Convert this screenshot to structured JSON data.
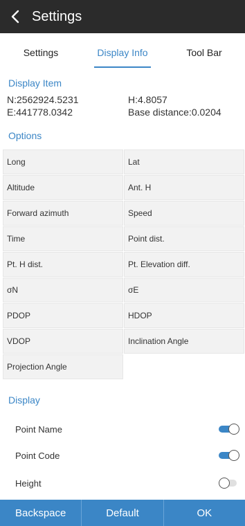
{
  "header": {
    "title": "Settings"
  },
  "tabs": [
    {
      "label": "Settings",
      "active": false
    },
    {
      "label": "Display Info",
      "active": true
    },
    {
      "label": "Tool Bar",
      "active": false
    }
  ],
  "display_item": {
    "title": "Display Item",
    "rows": [
      {
        "left": "N:2562924.5231",
        "right": "H:4.8057"
      },
      {
        "left": "E:441778.0342",
        "right": "Base distance:0.0204"
      }
    ]
  },
  "options": {
    "title": "Options",
    "items": [
      "Long",
      "Lat",
      "Altitude",
      "Ant. H",
      "Forward azimuth",
      "Speed",
      "Time",
      "Point dist.",
      "Pt. H dist.",
      "Pt. Elevation diff.",
      "σN",
      "σE",
      "PDOP",
      "HDOP",
      "VDOP",
      "Inclination Angle",
      "Projection Angle"
    ]
  },
  "display": {
    "title": "Display",
    "toggles": [
      {
        "label": "Point Name",
        "on": true
      },
      {
        "label": "Point Code",
        "on": true
      },
      {
        "label": "Height",
        "on": false
      }
    ]
  },
  "buttons": {
    "backspace": "Backspace",
    "default": "Default",
    "ok": "OK"
  },
  "colors": {
    "accent": "#3b86c6",
    "titlebar": "#2b2b2b",
    "cell": "#f2f2f2"
  }
}
